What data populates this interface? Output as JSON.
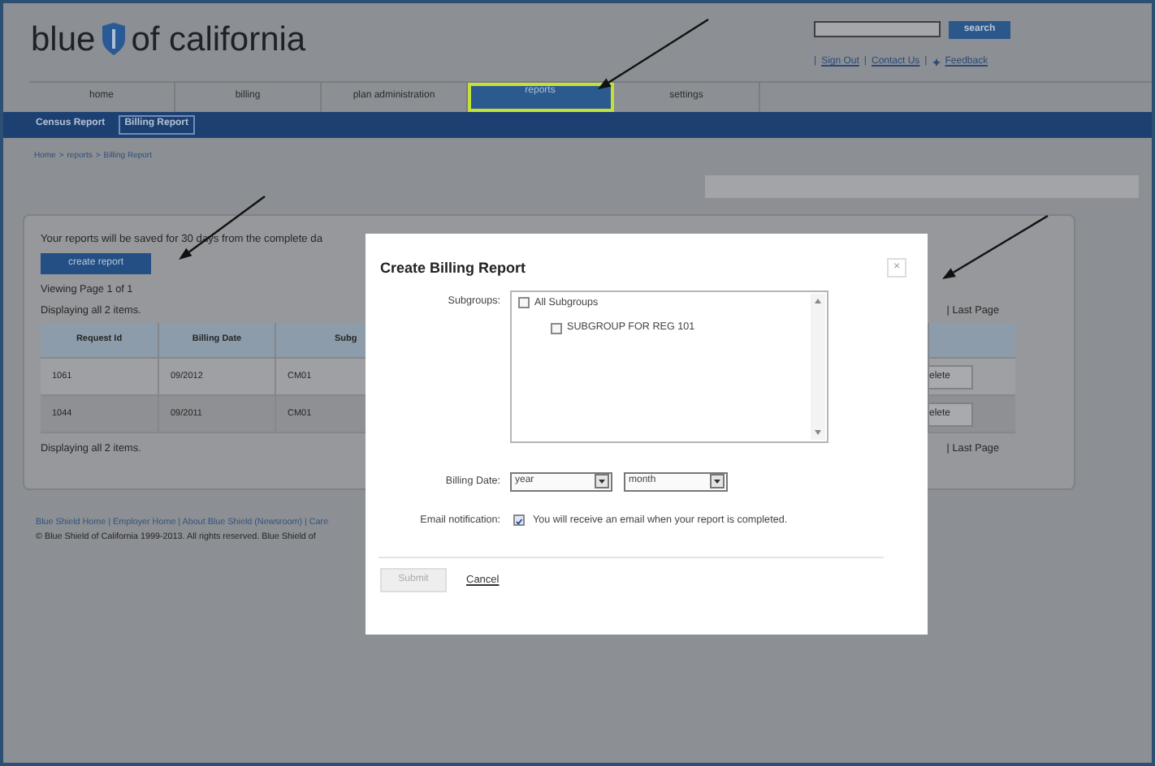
{
  "header": {
    "logo_left": "blue",
    "logo_right": "of california",
    "search_button": "search",
    "link_separator": "|",
    "links": [
      {
        "label": "Sign Out",
        "icon": false
      },
      {
        "label": "Contact Us",
        "icon": false
      },
      {
        "label": "Feedback",
        "icon": true
      }
    ]
  },
  "main_tabs": [
    {
      "label": "home",
      "selected": false
    },
    {
      "label": "billing",
      "selected": false
    },
    {
      "label": "plan administration",
      "selected": false
    },
    {
      "label": "reports",
      "selected": true
    },
    {
      "label": "settings",
      "selected": false
    }
  ],
  "sub_tabs": [
    {
      "label": "Census Report",
      "selected": false
    },
    {
      "label": "Billing Report",
      "selected": true
    }
  ],
  "breadcrumb": {
    "separator": ">",
    "items": [
      "Home",
      "reports",
      "Billing Report"
    ]
  },
  "panel": {
    "note": "Your reports will be saved for 30 days from the complete da",
    "create_button": "create report",
    "viewing": "Viewing Page 1 of 1",
    "displaying_top": "Displaying all 2 items.",
    "pager_top": "| Last Page",
    "table": {
      "columns": [
        "Request Id",
        "Billing Date",
        "Subg"
      ],
      "rows": [
        {
          "cells": [
            "1061",
            "09/2012",
            "CM01"
          ],
          "action": "elete"
        },
        {
          "cells": [
            "1044",
            "09/2011",
            "CM01"
          ],
          "action": "elete"
        }
      ]
    },
    "displaying_bottom": "Displaying all 2 items.",
    "pager_bottom": "| Last Page"
  },
  "footer": {
    "links": "Blue Shield Home | Employer Home | About Blue Shield (Newsroom) | Care",
    "copyright": "© Blue Shield of California 1999-2013. All rights reserved. Blue Shield of"
  },
  "modal": {
    "title": "Create Billing Report",
    "close": "×",
    "subgroups_label": "Subgroups:",
    "subgroups": [
      {
        "label": "All Subgroups",
        "checked": false,
        "children": [
          {
            "label": "SUBGROUP FOR REG 101",
            "checked": false
          }
        ]
      }
    ],
    "billing_date_label": "Billing Date:",
    "year": "year",
    "month": "month",
    "email_label": "Email notification:",
    "email_checked": true,
    "email_text": "You will receive an email when your report is completed.",
    "submit": {
      "label": "Submit",
      "disabled": true
    },
    "cancel": "Cancel"
  }
}
